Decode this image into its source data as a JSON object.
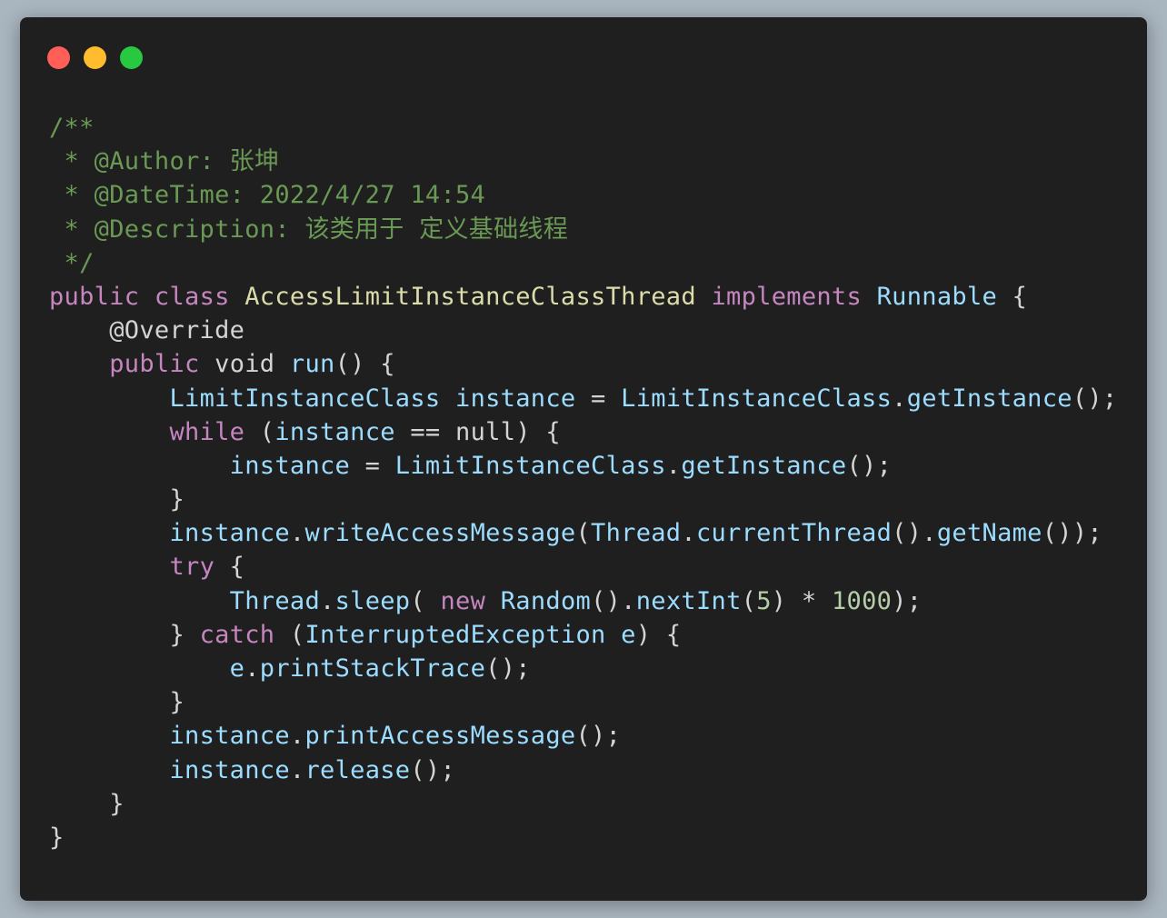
{
  "window": {
    "traffic_lights": [
      {
        "name": "close",
        "color": "#ff5f57"
      },
      {
        "name": "minimize",
        "color": "#febc2e"
      },
      {
        "name": "maximize",
        "color": "#28c840"
      }
    ]
  },
  "code": {
    "language": "java",
    "lines": [
      [
        {
          "t": "/**",
          "k": "comment"
        }
      ],
      [
        {
          "t": " * @Author: 张坤",
          "k": "comment"
        }
      ],
      [
        {
          "t": " * @DateTime: 2022/4/27 14:54",
          "k": "comment"
        }
      ],
      [
        {
          "t": " * @Description: 该类用于 定义基础线程",
          "k": "comment"
        }
      ],
      [
        {
          "t": " */",
          "k": "comment"
        }
      ],
      [
        {
          "t": "public",
          "k": "keyword"
        },
        {
          "t": " ",
          "k": "plain"
        },
        {
          "t": "class",
          "k": "keyword"
        },
        {
          "t": " ",
          "k": "plain"
        },
        {
          "t": "AccessLimitInstanceClassThread",
          "k": "type"
        },
        {
          "t": " ",
          "k": "plain"
        },
        {
          "t": "implements",
          "k": "keyword"
        },
        {
          "t": " ",
          "k": "plain"
        },
        {
          "t": "Runnable",
          "k": "type2"
        },
        {
          "t": " {",
          "k": "punct"
        }
      ],
      [
        {
          "t": "    @Override",
          "k": "annot"
        }
      ],
      [
        {
          "t": "    ",
          "k": "plain"
        },
        {
          "t": "public",
          "k": "keyword"
        },
        {
          "t": " void ",
          "k": "plain"
        },
        {
          "t": "run",
          "k": "method"
        },
        {
          "t": "() {",
          "k": "punct"
        }
      ],
      [
        {
          "t": "        ",
          "k": "plain"
        },
        {
          "t": "LimitInstanceClass",
          "k": "ident"
        },
        {
          "t": " ",
          "k": "plain"
        },
        {
          "t": "instance",
          "k": "ident"
        },
        {
          "t": " = ",
          "k": "punct"
        },
        {
          "t": "LimitInstanceClass",
          "k": "ident"
        },
        {
          "t": ".",
          "k": "punct"
        },
        {
          "t": "getInstance",
          "k": "method"
        },
        {
          "t": "();",
          "k": "punct"
        }
      ],
      [
        {
          "t": "        ",
          "k": "plain"
        },
        {
          "t": "while",
          "k": "keyword"
        },
        {
          "t": " (",
          "k": "punct"
        },
        {
          "t": "instance",
          "k": "ident"
        },
        {
          "t": " == null) {",
          "k": "punct"
        }
      ],
      [
        {
          "t": "            ",
          "k": "plain"
        },
        {
          "t": "instance",
          "k": "ident"
        },
        {
          "t": " = ",
          "k": "punct"
        },
        {
          "t": "LimitInstanceClass",
          "k": "ident"
        },
        {
          "t": ".",
          "k": "punct"
        },
        {
          "t": "getInstance",
          "k": "method"
        },
        {
          "t": "();",
          "k": "punct"
        }
      ],
      [
        {
          "t": "        }",
          "k": "punct"
        }
      ],
      [
        {
          "t": "        ",
          "k": "plain"
        },
        {
          "t": "instance",
          "k": "ident"
        },
        {
          "t": ".",
          "k": "punct"
        },
        {
          "t": "writeAccessMessage",
          "k": "method"
        },
        {
          "t": "(",
          "k": "punct"
        },
        {
          "t": "Thread",
          "k": "ident"
        },
        {
          "t": ".",
          "k": "punct"
        },
        {
          "t": "currentThread",
          "k": "method"
        },
        {
          "t": "().",
          "k": "punct"
        },
        {
          "t": "getName",
          "k": "method"
        },
        {
          "t": "());",
          "k": "punct"
        }
      ],
      [
        {
          "t": "        ",
          "k": "plain"
        },
        {
          "t": "try",
          "k": "keyword"
        },
        {
          "t": " {",
          "k": "punct"
        }
      ],
      [
        {
          "t": "            ",
          "k": "plain"
        },
        {
          "t": "Thread",
          "k": "ident"
        },
        {
          "t": ".",
          "k": "punct"
        },
        {
          "t": "sleep",
          "k": "method"
        },
        {
          "t": "( ",
          "k": "punct"
        },
        {
          "t": "new",
          "k": "keyword"
        },
        {
          "t": " ",
          "k": "plain"
        },
        {
          "t": "Random",
          "k": "ident"
        },
        {
          "t": "().",
          "k": "punct"
        },
        {
          "t": "nextInt",
          "k": "method"
        },
        {
          "t": "(",
          "k": "punct"
        },
        {
          "t": "5",
          "k": "number"
        },
        {
          "t": ") * ",
          "k": "punct"
        },
        {
          "t": "1000",
          "k": "number"
        },
        {
          "t": ");",
          "k": "punct"
        }
      ],
      [
        {
          "t": "        } ",
          "k": "punct"
        },
        {
          "t": "catch",
          "k": "keyword"
        },
        {
          "t": " (",
          "k": "punct"
        },
        {
          "t": "InterruptedException",
          "k": "ident"
        },
        {
          "t": " ",
          "k": "plain"
        },
        {
          "t": "e",
          "k": "ident"
        },
        {
          "t": ") {",
          "k": "punct"
        }
      ],
      [
        {
          "t": "            ",
          "k": "plain"
        },
        {
          "t": "e",
          "k": "ident"
        },
        {
          "t": ".",
          "k": "punct"
        },
        {
          "t": "printStackTrace",
          "k": "method"
        },
        {
          "t": "();",
          "k": "punct"
        }
      ],
      [
        {
          "t": "        }",
          "k": "punct"
        }
      ],
      [
        {
          "t": "        ",
          "k": "plain"
        },
        {
          "t": "instance",
          "k": "ident"
        },
        {
          "t": ".",
          "k": "punct"
        },
        {
          "t": "printAccessMessage",
          "k": "method"
        },
        {
          "t": "();",
          "k": "punct"
        }
      ],
      [
        {
          "t": "        ",
          "k": "plain"
        },
        {
          "t": "instance",
          "k": "ident"
        },
        {
          "t": ".",
          "k": "punct"
        },
        {
          "t": "release",
          "k": "method"
        },
        {
          "t": "();",
          "k": "punct"
        }
      ],
      [
        {
          "t": "    }",
          "k": "punct"
        }
      ],
      [
        {
          "t": "}",
          "k": "punct"
        }
      ]
    ]
  }
}
